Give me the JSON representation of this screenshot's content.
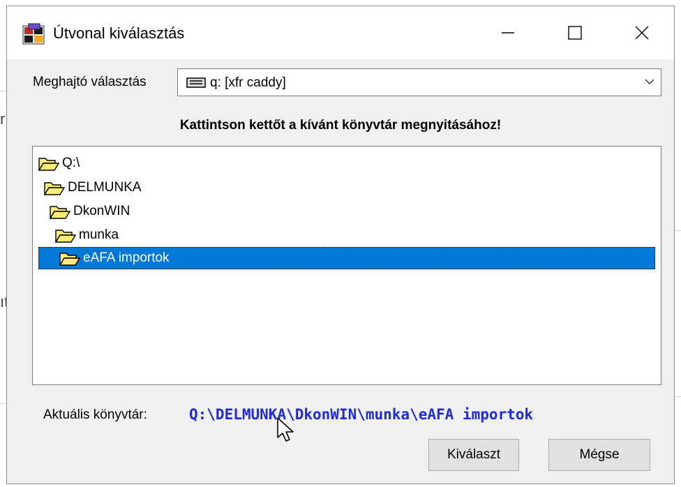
{
  "window": {
    "title": "Útvonal kiválasztás",
    "controls": {
      "minimize": "minimize-icon",
      "maximize": "maximize-icon",
      "close": "close-icon"
    }
  },
  "background": {
    "fragment_1": "r",
    "fragment_2": "ıt"
  },
  "drive": {
    "label": "Meghajtó választás",
    "selected": "q: [xfr caddy]",
    "icon": "network-drive-icon"
  },
  "instruction": "Kattintson kettőt a kívánt könyvtár megnyitásához!",
  "tree": {
    "items": [
      {
        "label": "Q:\\",
        "level": 0,
        "selected": false
      },
      {
        "label": "DELMUNKA",
        "level": 1,
        "selected": false
      },
      {
        "label": "DkonWIN",
        "level": 2,
        "selected": false
      },
      {
        "label": "munka",
        "level": 3,
        "selected": false
      },
      {
        "label": "eAFA importok",
        "level": 4,
        "selected": true
      }
    ]
  },
  "current": {
    "label": "Aktuális könyvtár:",
    "path": "Q:\\DELMUNKA\\DkonWIN\\munka\\eAFA importok"
  },
  "buttons": {
    "select": "Kiválaszt",
    "cancel": "Mégse"
  },
  "colors": {
    "selection": "#0078d7",
    "path_text": "#1f2bd6",
    "folder": "#ffeb7a"
  }
}
